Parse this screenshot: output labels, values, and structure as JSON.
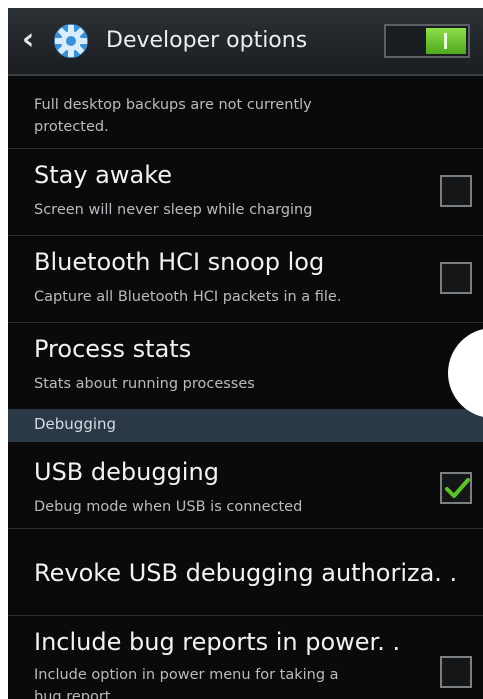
{
  "action_bar": {
    "back_icon": "chevron-left-icon",
    "settings_icon": "gear-icon",
    "title": "Developer options",
    "master_switch_on": true,
    "accent_color": "#5cc227"
  },
  "items": [
    {
      "title": "",
      "subtitle_line1": "Full desktop backups are not currently",
      "subtitle_line2": "protected."
    },
    {
      "title": "Stay awake",
      "subtitle": "Screen will never sleep while charging",
      "checked": false
    },
    {
      "title": "Bluetooth HCI snoop log",
      "subtitle": "Capture all Bluetooth HCI packets in a file.",
      "checked": false
    },
    {
      "title": "Process stats",
      "subtitle": "Stats about running processes"
    }
  ],
  "section": {
    "label": "Debugging"
  },
  "debug_items": [
    {
      "title": "USB debugging",
      "subtitle": "Debug mode when USB is connected",
      "checked": true
    },
    {
      "title": "Revoke USB debugging authoriza. ."
    },
    {
      "title": "Include bug reports in power. .",
      "subtitle_line1": "Include option in power menu for taking a",
      "subtitle_line2": "bug report.",
      "checked": false
    }
  ]
}
